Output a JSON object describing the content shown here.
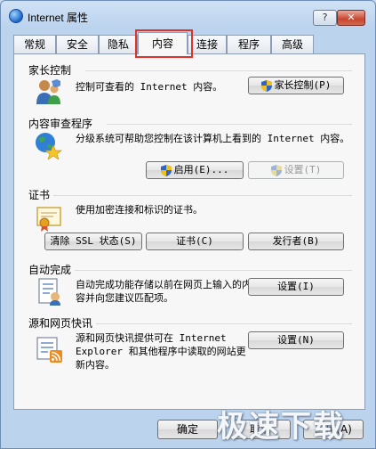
{
  "window": {
    "title": "Internet 属性",
    "help_label": "?",
    "close_label": "✕"
  },
  "tabs": [
    {
      "label": "常规"
    },
    {
      "label": "安全"
    },
    {
      "label": "隐私"
    },
    {
      "label": "内容"
    },
    {
      "label": "连接"
    },
    {
      "label": "程序"
    },
    {
      "label": "高级"
    }
  ],
  "active_tab": "内容",
  "sections": {
    "parental": {
      "title": "家长控制",
      "desc": "控制可查看的 Internet 内容。",
      "button": "家长控制(P)"
    },
    "advisor": {
      "title": "内容审查程序",
      "desc": "分级系统可帮助您控制在该计算机上看到的 Internet 内容。",
      "enable_button": "启用(E)...",
      "settings_button": "设置(T)"
    },
    "certificates": {
      "title": "证书",
      "desc": "使用加密连接和标识的证书。",
      "clear_ssl_button": "清除 SSL 状态(S)",
      "certs_button": "证书(C)",
      "publishers_button": "发行者(B)"
    },
    "autocomplete": {
      "title": "自动完成",
      "desc": "自动完成功能存储以前在网页上输入的内容并向您建议匹配项。",
      "settings_button": "设置(I)"
    },
    "feeds": {
      "title": "源和网页快讯",
      "desc": "源和网页快讯提供可在 Internet Explorer 和其他程序中读取的网站更新内容。",
      "settings_button": "设置(N)"
    }
  },
  "footer": {
    "ok": "确定",
    "cancel": "取消",
    "apply": "应用(A)"
  },
  "watermark": "极速下载站",
  "colors": {
    "tab_highlight": "#e0322b",
    "window_frame": "#bcd3ee",
    "panel": "#f7f7f7"
  }
}
